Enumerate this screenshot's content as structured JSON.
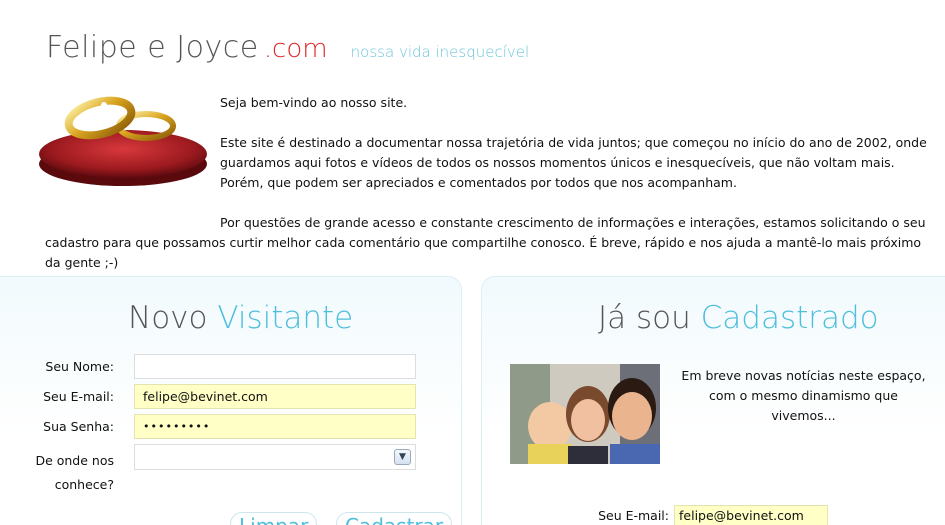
{
  "header": {
    "site_name": "Felipe e Joyce",
    "domain_suffix": ".com",
    "tagline": "nossa vida inesquecível"
  },
  "intro": {
    "welcome": "Seja bem-vindo ao nosso site.",
    "paragraph1": "Este site é destinado a documentar nossa trajetória de vida juntos; que começou no início do ano de 2002, onde guardamos aqui fotos e vídeos de todos os nossos momentos únicos e inesquecíveis, que não voltam mais. Porém, que podem ser apreciados e comentados por todos que nos acompanham.",
    "paragraph2": "Por questões de grande acesso e constante crescimento de informações e interações, estamos solicitando o seu cadastro para que possamos curtir melhor cada comentário que compartilhe conosco. É breve, rápido e nos ajuda a mantê-lo mais próximo da gente ;-)"
  },
  "new_visitor": {
    "title_main": "Novo",
    "title_highlight": "Visitante",
    "name_label": "Seu Nome:",
    "name_value": "",
    "email_label": "Seu E-mail:",
    "email_value": "felipe@bevinet.com",
    "password_label": "Sua Senha:",
    "password_value": "•••••••••",
    "source_label_line1": "De onde nos",
    "source_label_line2": "conhece?",
    "source_value": "",
    "clear_button": "Limpar",
    "register_button": "Cadastrar"
  },
  "registered": {
    "title_main": "Já sou",
    "title_highlight": "Cadastrado",
    "news_line1": "Em breve novas notícias neste espaço,",
    "news_line2": "com o mesmo dinamismo que vivemos...",
    "email_label": "Seu E-mail:",
    "email_value": "felipe@bevinet.com"
  },
  "colors": {
    "accent": "#4dbfda",
    "domain_red": "#e02525",
    "autofill": "#ffffc6"
  }
}
